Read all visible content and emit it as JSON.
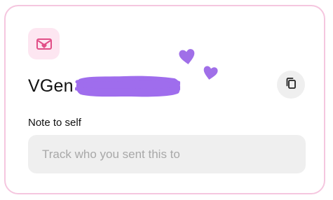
{
  "colors": {
    "card_border": "#f5c6df",
    "icon_tile_bg": "#fde6f1",
    "icon_accent": "#e14f87",
    "heart_color": "#a06fe8",
    "redaction_color": "#9f6ded",
    "input_bg": "#efefef",
    "copy_button_bg": "#efefef"
  },
  "card": {
    "icon": "mail-heart-icon",
    "title_prefix": "VGen",
    "copy_icon": "copy-icon"
  },
  "note": {
    "label": "Note to self",
    "placeholder": "Track who you sent this to",
    "value": ""
  }
}
